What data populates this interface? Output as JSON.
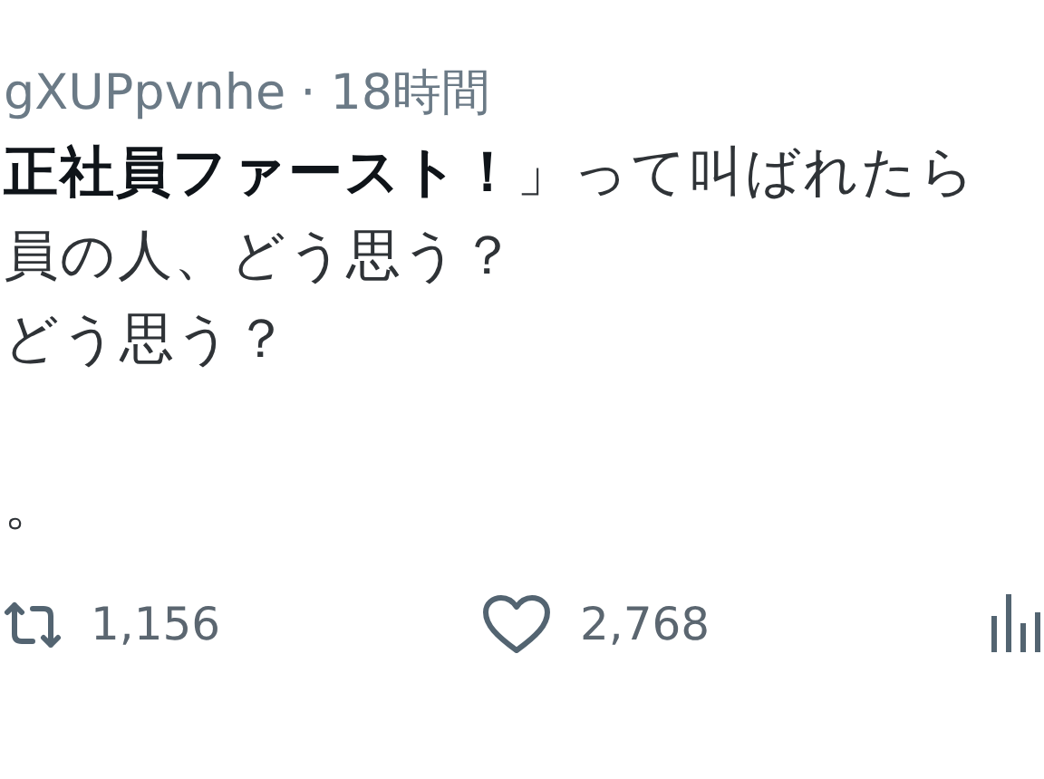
{
  "header": {
    "handle": "gXUPpvnhe",
    "separator": "·",
    "time": "18時間"
  },
  "body_paragraphs": [
    [
      "**正社員ファースト！**」って叫ばれたら",
      "員の人、どう思う？",
      "どう思う？"
    ],
    [
      "。"
    ]
  ],
  "actions": [
    {
      "kind": "retweet",
      "count": "1,156"
    },
    {
      "kind": "like",
      "count": "2,768"
    },
    {
      "kind": "views"
    }
  ]
}
